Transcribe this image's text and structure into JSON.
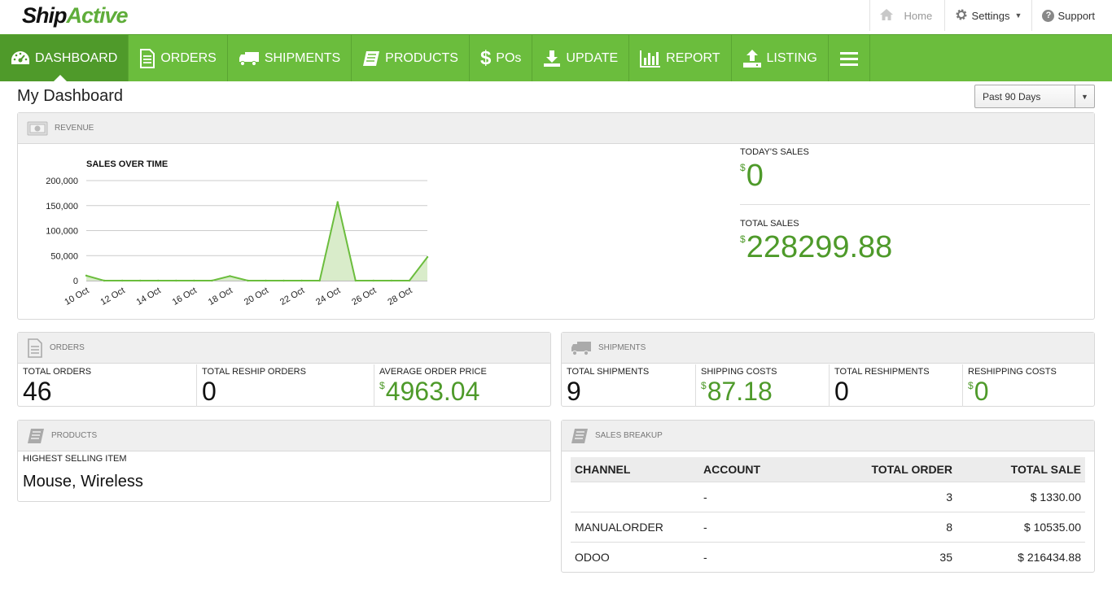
{
  "app": {
    "logo_part1": "Ship",
    "logo_part2": "Active"
  },
  "toplinks": {
    "home": "Home",
    "settings": "Settings",
    "support": "Support"
  },
  "nav": {
    "items": [
      {
        "label": "DASHBOARD"
      },
      {
        "label": "ORDERS"
      },
      {
        "label": "SHIPMENTS"
      },
      {
        "label": "PRODUCTS"
      },
      {
        "label": "POs"
      },
      {
        "label": "UPDATE"
      },
      {
        "label": "REPORT"
      },
      {
        "label": "LISTING"
      }
    ]
  },
  "page": {
    "title": "My Dashboard",
    "period": "Past 90 Days"
  },
  "revenue": {
    "header": "REVENUE",
    "chart_title": "SALES OVER TIME",
    "todays_sales_label": "TODAY'S SALES",
    "todays_sales_currency": "$",
    "todays_sales_value": "0",
    "total_sales_label": "TOTAL SALES",
    "total_sales_currency": "$",
    "total_sales_value": "228299.88"
  },
  "chart_data": {
    "type": "area",
    "title": "SALES OVER TIME",
    "xlabel": "",
    "ylabel": "",
    "ylim": [
      0,
      200000
    ],
    "y_ticks": [
      "0",
      "50,000",
      "100,000",
      "150,000",
      "200,000"
    ],
    "x_ticks": [
      "10 Oct",
      "12 Oct",
      "14 Oct",
      "16 Oct",
      "18 Oct",
      "20 Oct",
      "22 Oct",
      "24 Oct",
      "26 Oct",
      "28 Oct"
    ],
    "x": [
      "10 Oct",
      "11 Oct",
      "12 Oct",
      "13 Oct",
      "14 Oct",
      "15 Oct",
      "16 Oct",
      "17 Oct",
      "18 Oct",
      "19 Oct",
      "20 Oct",
      "21 Oct",
      "22 Oct",
      "23 Oct",
      "24 Oct",
      "25 Oct",
      "26 Oct",
      "27 Oct",
      "28 Oct",
      "29 Oct"
    ],
    "values": [
      10000,
      0,
      0,
      0,
      0,
      0,
      0,
      0,
      9000,
      0,
      0,
      0,
      0,
      0,
      157000,
      0,
      0,
      0,
      0,
      47000
    ],
    "grid": true,
    "color": "#6bbd3d"
  },
  "orders": {
    "header": "ORDERS",
    "total_orders_label": "TOTAL ORDERS",
    "total_orders_value": "46",
    "reship_label": "TOTAL RESHIP ORDERS",
    "reship_value": "0",
    "avg_price_label": "AVERAGE ORDER PRICE",
    "avg_price_currency": "$",
    "avg_price_value": "4963.04"
  },
  "shipments": {
    "header": "SHIPMENTS",
    "total_label": "TOTAL SHIPMENTS",
    "total_value": "9",
    "costs_label": "SHIPPING COSTS",
    "costs_currency": "$",
    "costs_value": "87.18",
    "reship_label": "TOTAL RESHIPMENTS",
    "reship_value": "0",
    "reship_costs_label": "RESHIPPING COSTS",
    "reship_costs_currency": "$",
    "reship_costs_value": "0"
  },
  "products": {
    "header": "PRODUCTS",
    "highest_label": "HIGHEST SELLING ITEM",
    "highest_value": "Mouse, Wireless"
  },
  "sales_breakup": {
    "header": "SALES BREAKUP",
    "columns": [
      "CHANNEL",
      "ACCOUNT",
      "TOTAL ORDER",
      "TOTAL SALE"
    ],
    "rows": [
      {
        "channel": "",
        "account": "-",
        "total_order": "3",
        "total_sale": "$ 1330.00"
      },
      {
        "channel": "MANUALORDER",
        "account": "-",
        "total_order": "8",
        "total_sale": "$ 10535.00"
      },
      {
        "channel": "ODOO",
        "account": "-",
        "total_order": "35",
        "total_sale": "$ 216434.88"
      }
    ]
  },
  "colors": {
    "brand_green": "#6bbd3d",
    "value_green": "#4e9a2a"
  }
}
